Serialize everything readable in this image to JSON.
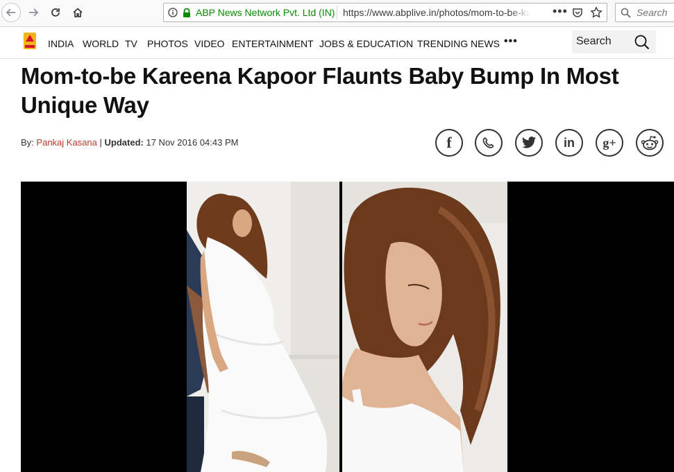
{
  "browser": {
    "site_identity": "ABP News Network Pvt. Ltd (IN)",
    "url": "https://www.abplive.in/photos/mom-to-be-kareena-kapoor-flaunts-baby-bump",
    "search_placeholder": "Search",
    "secure_color": "#058b00"
  },
  "nav": {
    "items": [
      "INDIA",
      "WORLD",
      "TV",
      "PHOTOS",
      "VIDEO",
      "ENTERTAINMENT",
      "JOBS & EDUCATION",
      "TRENDING NEWS"
    ],
    "more": "•••",
    "search_placeholder": "Search"
  },
  "article": {
    "headline": "Mom-to-be Kareena Kapoor Flaunts Baby Bump In Most Unique Way",
    "by_label": "By:",
    "author": "Pankaj Kasana",
    "separator": "|",
    "updated_label": "Updated:",
    "updated_value": "17 Nov 2016 04:43 PM",
    "author_color": "#c0392b"
  },
  "share": {
    "icons": [
      "facebook-icon",
      "whatsapp-icon",
      "twitter-icon",
      "linkedin-icon",
      "google-plus-icon",
      "reddit-icon"
    ],
    "facebook": "f",
    "linkedin": "in",
    "google_plus": "g+"
  },
  "gallery": {
    "background": "#000000"
  }
}
